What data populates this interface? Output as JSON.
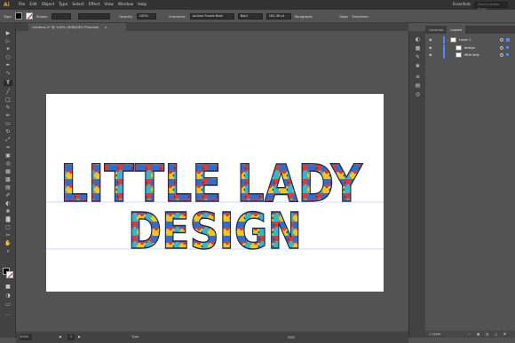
{
  "menubar": {
    "logo": "Ai",
    "items": [
      "File",
      "Edit",
      "Object",
      "Type",
      "Select",
      "Effect",
      "View",
      "Window",
      "Help"
    ],
    "workspace": "Essentials",
    "search_placeholder": "Search Adobe Stock"
  },
  "control": {
    "type_label": "Type",
    "stroke_label": "Stroke:",
    "opacity_label": "Opacity:",
    "opacity_value": "100%",
    "character_label": "Character:",
    "font_name": "Autism Puzzle Bold",
    "font_style": "Bold",
    "font_size": "162.36 pt",
    "paragraph_label": "Paragraph:",
    "align_label": "Align",
    "transform_label": "Transform"
  },
  "document": {
    "tab_title": "Untitled-2* @ 100% (RGB/GPU Preview)",
    "close_glyph": "×"
  },
  "artwork": {
    "line1": "LITTLE LADY",
    "line2": "DESIGN"
  },
  "panel": {
    "tabs": [
      "Libraries",
      "Layers"
    ],
    "active_tab": "Layers",
    "layers": [
      {
        "name": "Layer 1"
      },
      {
        "name": "design"
      },
      {
        "name": "little lady"
      }
    ],
    "footer": "1 Layer"
  },
  "status": {
    "zoom": "100%",
    "page": "1",
    "tool": "Type"
  },
  "colors": {
    "accent": "#4a8cff",
    "logo": "#ff9a00",
    "puzzle_red": "#e23b2e",
    "puzzle_blue": "#2b6fd6",
    "puzzle_yellow": "#f5c518",
    "puzzle_teal": "#38b6c9"
  }
}
